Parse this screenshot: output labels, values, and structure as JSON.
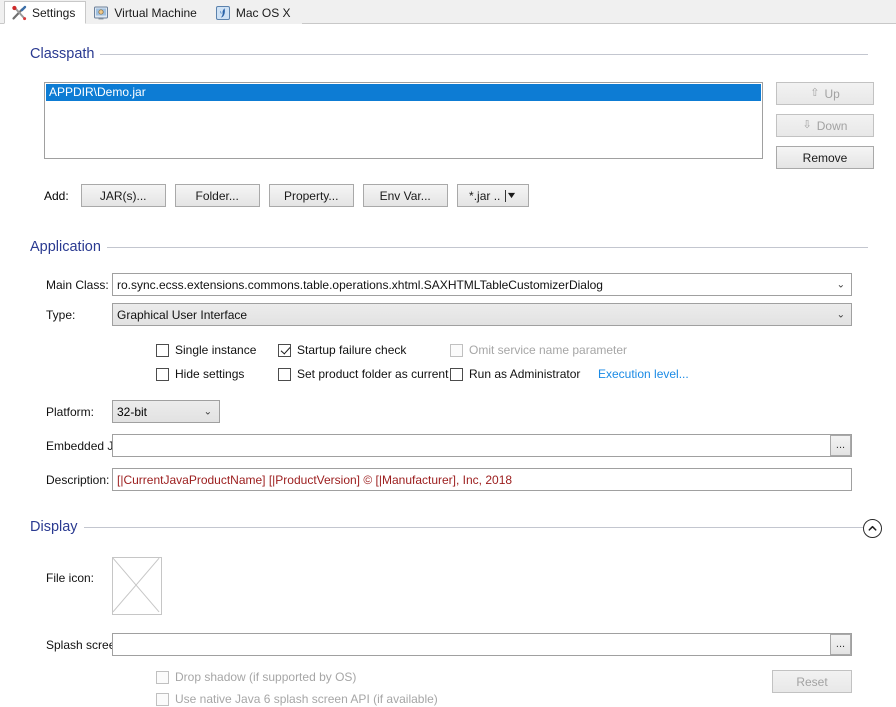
{
  "window": {
    "title": "Settings"
  },
  "tabs": [
    {
      "label": "Settings",
      "icon": "tools-icon",
      "active": true
    },
    {
      "label": "Virtual Machine",
      "icon": "monitor-icon",
      "active": false
    },
    {
      "label": "Mac OS X",
      "icon": "apple-platform-icon",
      "active": false
    }
  ],
  "classpath": {
    "section_title": "Classpath",
    "items": [
      {
        "text": "APPDIR\\Demo.jar",
        "selected": true
      }
    ],
    "side_buttons": [
      {
        "label": "Up",
        "icon": "arrow-up-icon",
        "glyph": "⇧",
        "enabled": false
      },
      {
        "label": "Down",
        "icon": "arrow-down-icon",
        "glyph": "⇩",
        "enabled": false
      },
      {
        "label": "Remove",
        "icon": "",
        "glyph": "",
        "enabled": true
      }
    ],
    "add_label": "Add:",
    "add_buttons": [
      {
        "label": "JAR(s)..."
      },
      {
        "label": "Folder..."
      },
      {
        "label": "Property..."
      },
      {
        "label": "Env Var..."
      }
    ],
    "filter_combo": {
      "value": "*.jar ..",
      "caret_glyph": "▼"
    }
  },
  "application": {
    "section_title": "Application",
    "main_class": {
      "label": "Main Class:",
      "value": "ro.sync.ecss.extensions.commons.table.operations.xhtml.SAXHTMLTableCustomizerDialog",
      "placeholder": ""
    },
    "type": {
      "label": "Type:",
      "value": "Graphical User Interface"
    },
    "checkboxes": [
      {
        "label": "Single instance",
        "checked": false,
        "enabled": true
      },
      {
        "label": "Startup failure check",
        "checked": true,
        "enabled": true
      },
      {
        "label": "Omit service name parameter",
        "checked": false,
        "enabled": false
      },
      {
        "label": "Hide settings",
        "checked": false,
        "enabled": true
      },
      {
        "label": "Set product folder as current",
        "checked": false,
        "enabled": true
      },
      {
        "label": "Run as Administrator",
        "checked": false,
        "enabled": true
      }
    ],
    "execution_level_link": "Execution level...",
    "platform": {
      "label": "Platform:",
      "value": "32-bit"
    },
    "embedded_jar": {
      "label": "Embedded JAR:",
      "value": "",
      "browse_glyph": "..."
    },
    "description": {
      "label": "Description:",
      "value": "[|CurrentJavaProductName] [|ProductVersion] © [|Manufacturer], Inc, 2018"
    }
  },
  "display": {
    "section_title": "Display",
    "collapse_icon": "chevron-up-circle-icon",
    "file_icon": {
      "label": "File icon:"
    },
    "splash_screen": {
      "label": "Splash screen:",
      "value": "",
      "browse_glyph": "..."
    },
    "checkboxes": [
      {
        "label": "Drop shadow (if supported by OS)",
        "checked": false,
        "enabled": false
      },
      {
        "label": "Use native Java 6 splash screen API (if available)",
        "checked": false,
        "enabled": false
      }
    ],
    "reset_button": {
      "label": "Reset",
      "enabled": false
    }
  },
  "colors": {
    "section_title": "#2a3a91",
    "selection": "#0d7cd4",
    "link": "#1a8ae5",
    "description_text": "#9b1c1c"
  }
}
